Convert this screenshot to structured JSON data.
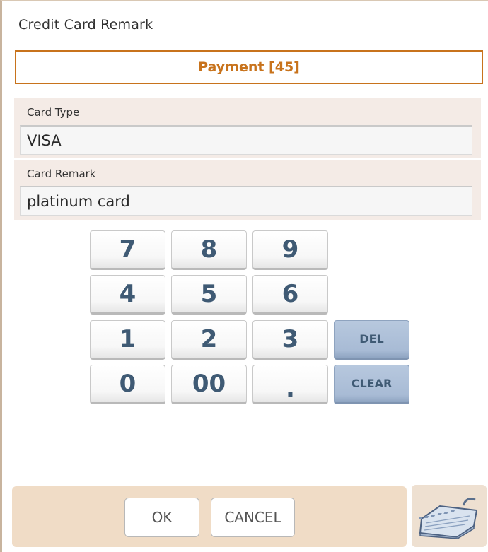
{
  "dialog": {
    "title": "Credit Card Remark"
  },
  "payment": {
    "label": "Payment [45]"
  },
  "card_type": {
    "label": "Card Type",
    "value": "VISA"
  },
  "card_remark": {
    "label": "Card Remark",
    "value": "platinum card"
  },
  "keypad": {
    "keys": [
      "7",
      "8",
      "9",
      "4",
      "5",
      "6",
      "1",
      "2",
      "3",
      "0",
      "00",
      "."
    ],
    "del_label": "DEL",
    "clear_label": "CLEAR"
  },
  "footer": {
    "ok_label": "OK",
    "cancel_label": "CANCEL",
    "keyboard_icon": "keyboard-icon"
  },
  "colors": {
    "accent": "#c8731c",
    "keypad_text": "#3f5a74",
    "function_key": "#a8bbd5",
    "footer_bg": "#f0dcc6"
  }
}
